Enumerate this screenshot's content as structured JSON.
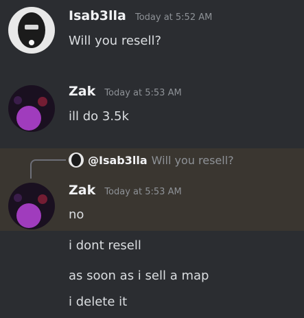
{
  "messages": [
    {
      "username": "Isab3lla",
      "timestamp": "Today at 5:52 AM",
      "lines": [
        "Will you resell?"
      ]
    },
    {
      "username": "Zak",
      "timestamp": "Today at 5:53 AM",
      "lines": [
        "ill do 3.5k"
      ]
    },
    {
      "username": "Zak",
      "timestamp": "Today at 5:53 AM",
      "reply": {
        "mention": "@Isab3lla",
        "text": "Will you resell?"
      },
      "lines": [
        "no",
        "i dont resell",
        "as soon as i sell a map",
        "i delete it"
      ]
    }
  ],
  "colors": {
    "background": "#2b2d31",
    "highlight": "#3a3630",
    "text": "#dbdee1",
    "muted": "#8e9297",
    "zak_avatar": "#b04cc8"
  }
}
